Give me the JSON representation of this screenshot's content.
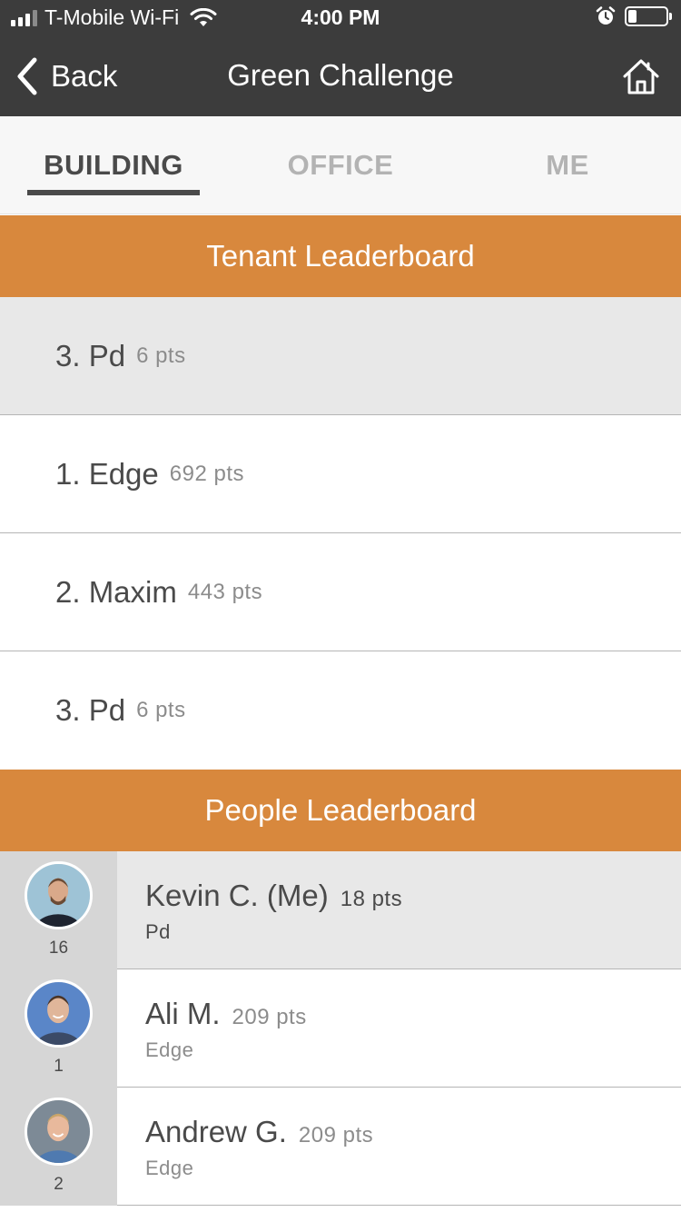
{
  "status_bar": {
    "carrier": "T-Mobile Wi-Fi",
    "time": "4:00 PM",
    "icons": [
      "signal-icon",
      "wifi-icon",
      "alarm-icon",
      "battery-icon"
    ]
  },
  "nav": {
    "back_label": "Back",
    "title": "Green Challenge",
    "home_icon": "home-icon"
  },
  "tabs": [
    {
      "label": "BUILDING",
      "active": true
    },
    {
      "label": "OFFICE",
      "active": false
    },
    {
      "label": "ME",
      "active": false
    }
  ],
  "tenant_leaderboard": {
    "title": "Tenant Leaderboard",
    "my_entry": {
      "name": "3. Pd",
      "pts": "6 pts"
    },
    "rows": [
      {
        "name": "1. Edge",
        "pts": "692 pts"
      },
      {
        "name": "2. Maxim",
        "pts": "443 pts"
      },
      {
        "name": "3. Pd",
        "pts": "6 pts"
      }
    ]
  },
  "people_leaderboard": {
    "title": "People Leaderboard",
    "rows": [
      {
        "rank": "16",
        "name": "Kevin C. (Me)",
        "pts": "18 pts",
        "tenant": "Pd"
      },
      {
        "rank": "1",
        "name": "Ali M.",
        "pts": "209 pts",
        "tenant": "Edge"
      },
      {
        "rank": "2",
        "name": "Andrew G.",
        "pts": "209 pts",
        "tenant": "Edge"
      }
    ]
  },
  "colors": {
    "bar_bg": "#3c3c3c",
    "accent_orange": "#d8883d",
    "highlight_row": "#e8e8e8",
    "rank_column": "#d6d6d6"
  }
}
